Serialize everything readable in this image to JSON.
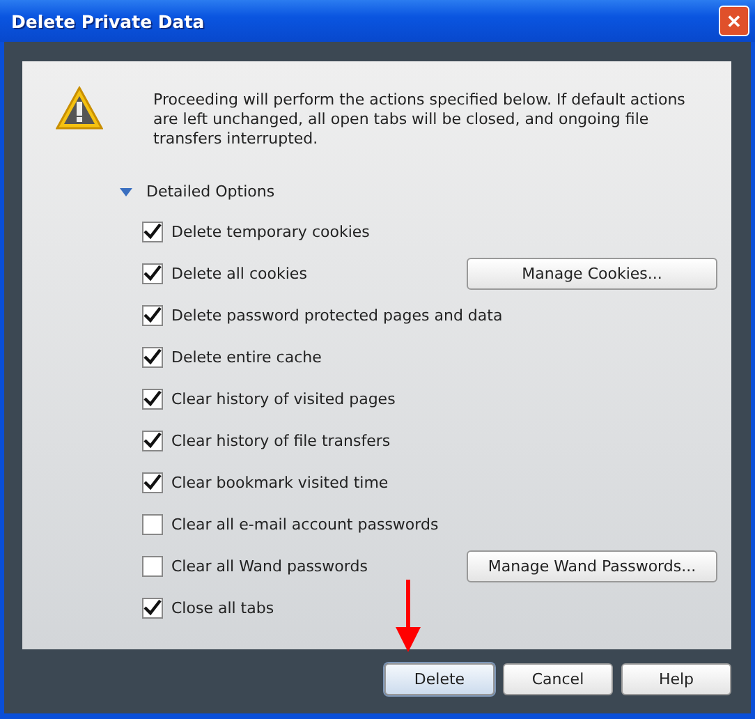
{
  "window": {
    "title": "Delete Private Data",
    "close": "✕"
  },
  "message": "Proceeding will perform the actions specified below. If default actions are left unchanged, all open tabs will be closed, and ongoing file transfers interrupted.",
  "details": {
    "label": "Detailed Options",
    "expanded": true
  },
  "options": [
    {
      "label": "Delete temporary cookies",
      "checked": true
    },
    {
      "label": "Delete all cookies",
      "checked": true,
      "button": "Manage Cookies..."
    },
    {
      "label": "Delete password protected pages and data",
      "checked": true
    },
    {
      "label": "Delete entire cache",
      "checked": true
    },
    {
      "label": "Clear history of visited pages",
      "checked": true
    },
    {
      "label": "Clear history of file transfers",
      "checked": true
    },
    {
      "label": "Clear bookmark visited time",
      "checked": true
    },
    {
      "label": "Clear all e-mail account passwords",
      "checked": false
    },
    {
      "label": "Clear all Wand passwords",
      "checked": false,
      "button": "Manage Wand Passwords..."
    },
    {
      "label": "Close all tabs",
      "checked": true
    }
  ],
  "buttons": [
    {
      "label": "Delete",
      "selected": true
    },
    {
      "label": "Cancel",
      "selected": false
    },
    {
      "label": "Help",
      "selected": false
    }
  ]
}
